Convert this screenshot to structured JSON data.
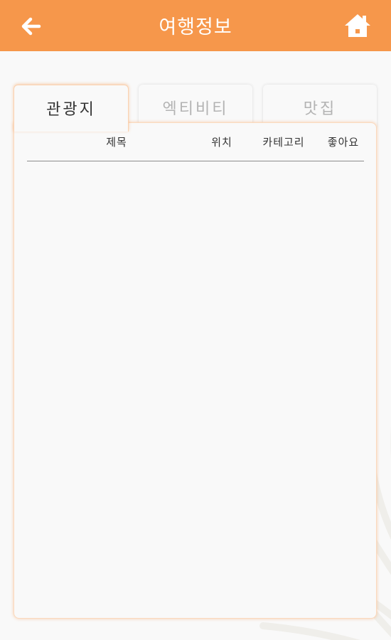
{
  "header": {
    "title": "여행정보",
    "back_icon": "arrow-left-icon",
    "home_icon": "home-icon",
    "background_color": "#f6974b"
  },
  "tabs": [
    {
      "label": "관광지",
      "active": true
    },
    {
      "label": "엑티비티",
      "active": false
    },
    {
      "label": "맛집",
      "active": false
    }
  ],
  "table": {
    "columns": [
      "제목",
      "위치",
      "카테고리",
      "좋아요"
    ],
    "rows": []
  },
  "colors": {
    "accent": "#f6974b",
    "background": "#f9f9f9",
    "active_tab_text": "#333333",
    "inactive_tab_text": "#b3b3b3"
  }
}
